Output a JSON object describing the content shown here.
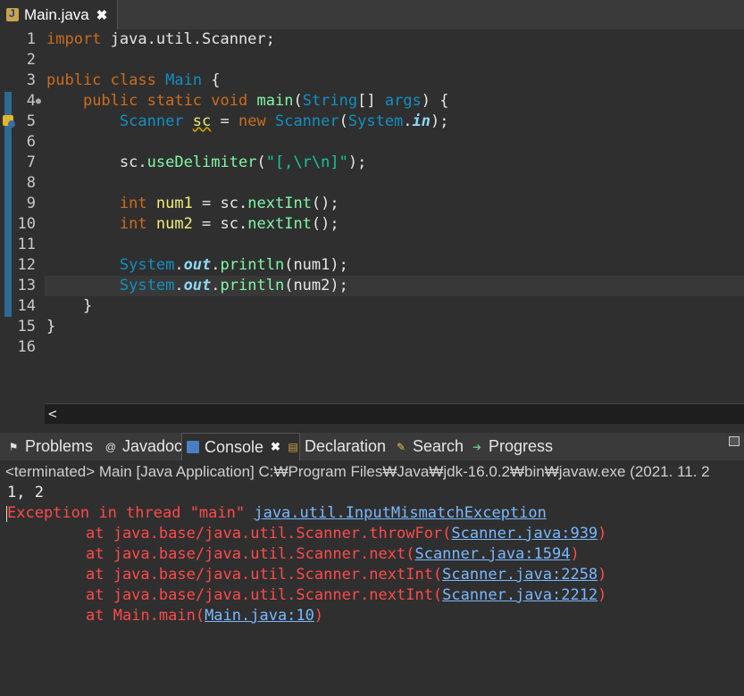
{
  "editor_tab": {
    "title": "Main.java",
    "close": "✖"
  },
  "code": {
    "line_numbers": [
      "1",
      "2",
      "3",
      "4",
      "5",
      "6",
      "7",
      "8",
      "9",
      "10",
      "11",
      "12",
      "13",
      "14",
      "15",
      "16"
    ],
    "l1": {
      "kw": "import",
      "rest": " java.util.Scanner;"
    },
    "l3": {
      "kw1": "public",
      "kw2": "class",
      "name": "Main",
      "brace": " {"
    },
    "l4": {
      "kw1": "public",
      "kw2": "static",
      "kw3": "void",
      "meth": "main",
      "p1": "(",
      "type": "String",
      "p2": "[] ",
      "arg": "args",
      "p3": ") {"
    },
    "l5": {
      "type1": "Scanner",
      "var": "sc",
      "eq": " = ",
      "kw": "new",
      "type2": "Scanner",
      "p1": "(",
      "type3": "System",
      "dot": ".",
      "field": "in",
      "p2": ");"
    },
    "l7": {
      "obj": "sc",
      "dot": ".",
      "meth": "useDelimiter",
      "p1": "(",
      "str": "\"[,\\r\\n]\"",
      "p2": ");"
    },
    "l9": {
      "kw": "int",
      "var": "num1",
      "eq": " = ",
      "obj": "sc",
      "dot": ".",
      "meth": "nextInt",
      "p": "();"
    },
    "l10": {
      "kw": "int",
      "var": "num2",
      "eq": " = ",
      "obj": "sc",
      "dot": ".",
      "meth": "nextInt",
      "p": "();"
    },
    "l12": {
      "type": "System",
      "dot1": ".",
      "field": "out",
      "dot2": ".",
      "meth": "println",
      "p1": "(",
      "arg": "num1",
      "p2": ");"
    },
    "l13": {
      "type": "System",
      "dot1": ".",
      "field": "out",
      "dot2": ".",
      "meth": "println",
      "p1": "(",
      "arg": "num2",
      "p2": ");"
    },
    "l14": "}",
    "l15": "}"
  },
  "scroll_arrow": "<",
  "views": {
    "problems": "Problems",
    "javadoc": "Javadoc",
    "console": "Console",
    "console_close": "✖",
    "declaration": "Declaration",
    "search": "Search",
    "progress": "Progress"
  },
  "console": {
    "status": "<terminated> Main [Java Application] C:₩Program Files₩Java₩jdk-16.0.2₩bin₩javaw.exe  (2021. 11. 2",
    "input": "1, 2",
    "exception_prefix": "Exception in thread \"main\" ",
    "exception_class": "java.util.InputMismatchException",
    "trace": [
      {
        "at": "\tat java.base/java.util.Scanner.throwFor(",
        "link": "Scanner.java:939",
        "end": ")"
      },
      {
        "at": "\tat java.base/java.util.Scanner.next(",
        "link": "Scanner.java:1594",
        "end": ")"
      },
      {
        "at": "\tat java.base/java.util.Scanner.nextInt(",
        "link": "Scanner.java:2258",
        "end": ")"
      },
      {
        "at": "\tat java.base/java.util.Scanner.nextInt(",
        "link": "Scanner.java:2212",
        "end": ")"
      },
      {
        "at": "\tat Main.main(",
        "link": "Main.java:10",
        "end": ")"
      }
    ]
  }
}
